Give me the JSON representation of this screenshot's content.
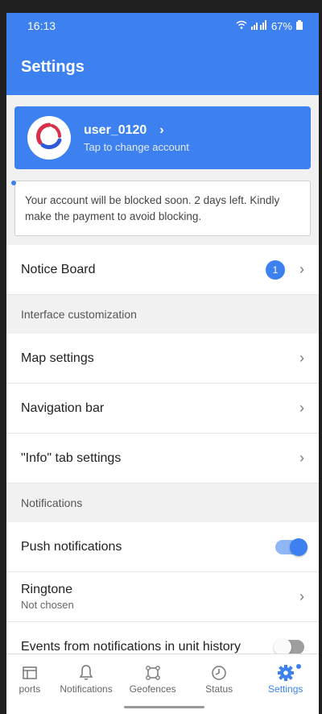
{
  "status_bar": {
    "time": "16:13",
    "battery": "67%"
  },
  "header": {
    "title": "Settings"
  },
  "account": {
    "username": "user_0120",
    "subtitle": "Tap to change account",
    "chevron": "›"
  },
  "warning": {
    "text": "Your account will be blocked soon. 2 days left. Kindly make the payment to avoid blocking."
  },
  "notice_board": {
    "label": "Notice Board",
    "badge": "1"
  },
  "sections": {
    "interface": "Interface customization",
    "notifications": "Notifications"
  },
  "rows": {
    "map_settings": "Map settings",
    "navigation_bar": "Navigation bar",
    "info_tab": "\"Info\" tab settings",
    "push_notifications": "Push notifications",
    "ringtone": "Ringtone",
    "ringtone_value": "Not chosen",
    "events_history": "Events from notifications in unit history"
  },
  "toggles": {
    "push_notifications": true,
    "events_history": false
  },
  "chevron": "›",
  "bottom_nav": {
    "reports": "ports",
    "notifications": "Notifications",
    "geofences": "Geofences",
    "status": "Status",
    "settings": "Settings"
  },
  "colors": {
    "accent": "#3d80f0",
    "background": "#f1f1f1"
  },
  "icons": [
    "wifi-icon",
    "signal-icon",
    "battery-icon",
    "logo-icon",
    "chevron-right-icon",
    "reports-icon",
    "bell-icon",
    "geofence-icon",
    "clock-icon",
    "gear-icon"
  ]
}
